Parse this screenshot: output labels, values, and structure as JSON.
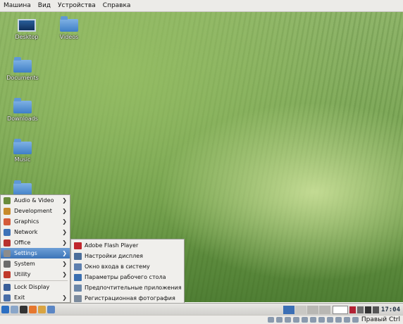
{
  "vbox_menu": [
    "Машина",
    "Вид",
    "Устройства",
    "Справка"
  ],
  "desktop_icons": [
    {
      "label": "Desktop",
      "type": "monitor"
    },
    {
      "label": "Videos",
      "type": "folder"
    },
    {
      "label": "Documents",
      "type": "folder"
    },
    {
      "label": "Downloads",
      "type": "folder"
    },
    {
      "label": "Music",
      "type": "folder"
    }
  ],
  "start_menu": {
    "items": [
      {
        "label": "Audio & Video",
        "icon": "audio-video-icon",
        "color": "#6a8c3c",
        "submenu": true
      },
      {
        "label": "Development",
        "icon": "development-icon",
        "color": "#c78a2b",
        "submenu": true
      },
      {
        "label": "Graphics",
        "icon": "graphics-icon",
        "color": "#d45b3a",
        "submenu": true
      },
      {
        "label": "Network",
        "icon": "network-icon",
        "color": "#3d72b8",
        "submenu": true
      },
      {
        "label": "Office",
        "icon": "office-icon",
        "color": "#b8322e",
        "submenu": true
      },
      {
        "label": "Settings",
        "icon": "settings-icon",
        "color": "#8c8c8c",
        "submenu": true,
        "active": true
      },
      {
        "label": "System",
        "icon": "system-icon",
        "color": "#6b6b6b",
        "submenu": true
      },
      {
        "label": "Utility",
        "icon": "utility-icon",
        "color": "#c0392b",
        "submenu": true
      }
    ],
    "bottom": [
      {
        "label": "Lock Display",
        "icon": "lock-display-icon",
        "color": "#3a5f99"
      },
      {
        "label": "Exit",
        "icon": "exit-icon",
        "color": "#4a6fa8",
        "submenu": true
      }
    ]
  },
  "submenu": [
    {
      "label": "Adobe Flash Player",
      "icon": "flash-player-icon",
      "color": "#c0262d"
    },
    {
      "label": "Настройки дисплея",
      "icon": "display-settings-icon",
      "color": "#4b6e9a"
    },
    {
      "label": "Окно входа в систему",
      "icon": "login-window-icon",
      "color": "#5d7fae"
    },
    {
      "label": "Параметры рабочего стола",
      "icon": "desktop-params-icon",
      "color": "#3a6fb0"
    },
    {
      "label": "Предпочтительные приложения",
      "icon": "preferred-apps-icon",
      "color": "#6b87a8"
    },
    {
      "label": "Регистрационная фотография",
      "icon": "login-photo-icon",
      "color": "#7c8b9d"
    },
    {
      "label": "Хранитель экрана",
      "icon": "screensaver-icon",
      "color": "#44566e"
    }
  ],
  "taskbar": {
    "launchers": [
      {
        "icon": "start-menu-icon",
        "color": "#2c6fc2"
      },
      {
        "icon": "show-desktop-icon",
        "color": "#8aa6c8"
      },
      {
        "icon": "terminal-icon",
        "color": "#333333"
      },
      {
        "icon": "firefox-icon",
        "color": "#e6772e"
      },
      {
        "icon": "text-editor-icon",
        "color": "#d9a441"
      },
      {
        "icon": "file-manager-icon",
        "color": "#5b86c4"
      }
    ],
    "workspaces": [
      "#3b6fb5",
      "#c9c8c4",
      "#b8b7b3",
      "#b8b7b3"
    ],
    "clock": "17:04",
    "tray": [
      {
        "icon": "keyboard-layout-flag-icon",
        "color": "#b22234"
      },
      {
        "icon": "pidgin-icon",
        "color": "#6b6b6b"
      },
      {
        "icon": "volume-icon",
        "color": "#333333"
      },
      {
        "icon": "network-tray-icon",
        "color": "#555555"
      }
    ]
  },
  "statusbar": {
    "host_key": "Правый Ctrl"
  }
}
